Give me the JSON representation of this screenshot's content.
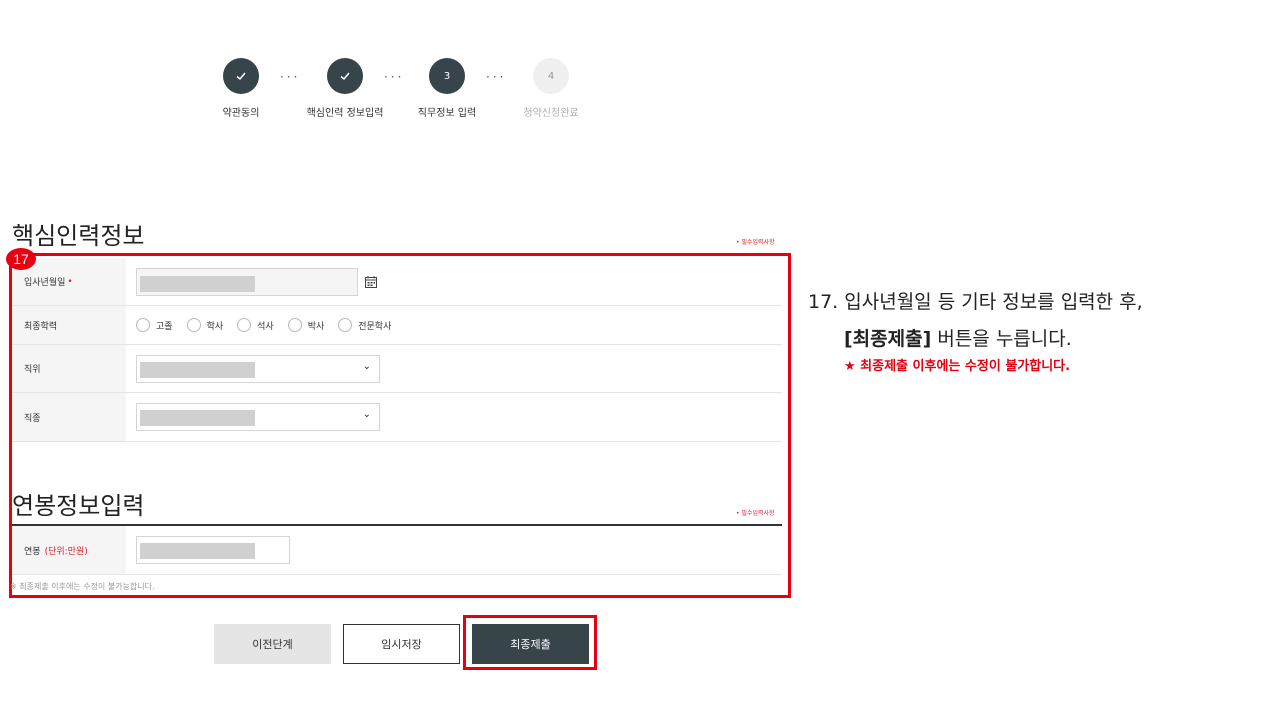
{
  "stepper": {
    "steps": [
      {
        "label": "약관동의",
        "num": "✓"
      },
      {
        "label": "핵심인력 정보입력",
        "num": "✓"
      },
      {
        "label": "직무정보 입력",
        "num": "3"
      },
      {
        "label": "청약신청완료",
        "num": "4"
      }
    ],
    "dots": "···"
  },
  "section1": {
    "title": "핵심인력정보",
    "required_note": "• 필수입력사항"
  },
  "badge": "17",
  "form": {
    "join_date_label": "입사년월일",
    "required_mark": "•",
    "education_label": "최종학력",
    "education_options": [
      "고졸",
      "학사",
      "석사",
      "박사",
      "전문학사"
    ],
    "position_label": "직위",
    "job_label": "직종"
  },
  "section2": {
    "title": "연봉정보입력",
    "required_note": "• 필수입력사항"
  },
  "salary": {
    "label": "연봉",
    "unit": "(단위:만원)"
  },
  "notice": "※ 최종제출 이후에는 수정이 불가능합니다.",
  "buttons": {
    "prev": "이전단계",
    "temp": "임시저장",
    "submit": "최종제출"
  },
  "instruction": {
    "line1": "17. 입사년월일 등 기타 정보를 입력한 후,",
    "line2_bold": "[최종제출]",
    "line2_rest": " 버튼을 누릅니다.",
    "warning": "★ 최종제출 이후에는 수정이 불가합니다."
  }
}
